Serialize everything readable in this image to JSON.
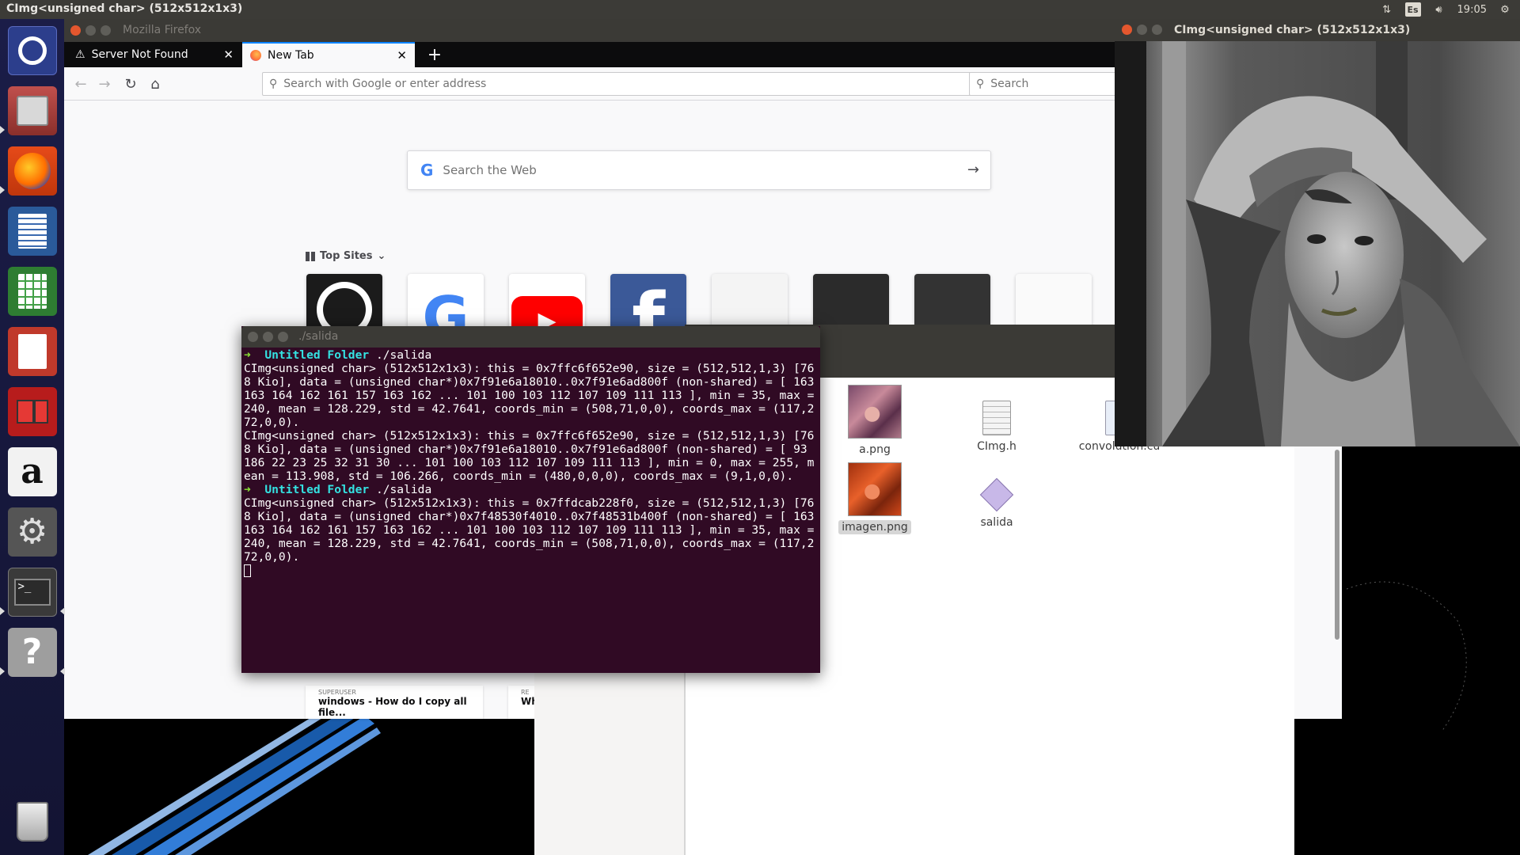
{
  "top_panel": {
    "title": "CImg<unsigned char> (512x512x1x3)",
    "keyboard": "Es",
    "clock": "19:05"
  },
  "launcher": {
    "items": [
      "ubuntu-dash",
      "files",
      "firefox",
      "libreoffice-writer",
      "libreoffice-calc",
      "libreoffice-impress",
      "software-center-red",
      "amazon",
      "system-settings",
      "terminal",
      "help",
      "trash"
    ]
  },
  "firefox": {
    "window_title": "Mozilla Firefox",
    "tabs": [
      {
        "label": "Server Not Found"
      },
      {
        "label": "New Tab"
      }
    ],
    "url_placeholder": "Search with Google or enter address",
    "search_placeholder": "Search",
    "web_search_placeholder": "Search the Web",
    "top_sites_label": "Top Sites",
    "highlights": [
      {
        "source": "SUPERUSER",
        "title": "windows - How do I copy all file..."
      },
      {
        "source": "RE",
        "title": "Wh"
      }
    ]
  },
  "file_manager": {
    "files": [
      {
        "name": "a.png"
      },
      {
        "name": "CImg.h"
      },
      {
        "name": "convolution.cu"
      },
      {
        "name": "imagen.png"
      },
      {
        "name": "salida"
      }
    ]
  },
  "cimg_window": {
    "title": "CImg<unsigned char> (512x512x1x3)"
  },
  "terminal": {
    "title": "./salida",
    "prompt_dir": "Untitled Folder",
    "command": "./salida",
    "output_1": "CImg<unsigned char> (512x512x1x3): this = 0x7ffc6f652e90, size = (512,512,1,3) [768 Kio], data = (unsigned char*)0x7f91e6a18010..0x7f91e6ad800f (non-shared) = [ 163 163 164 162 161 157 163 162 ... 101 100 103 112 107 109 111 113 ], min = 35, max = 240, mean = 128.229, std = 42.7641, coords_min = (508,71,0,0), coords_max = (117,272,0,0).",
    "output_2": "CImg<unsigned char> (512x512x1x3): this = 0x7ffc6f652e90, size = (512,512,1,3) [768 Kio], data = (unsigned char*)0x7f91e6a18010..0x7f91e6ad800f (non-shared) = [ 93 186 22 23 25 32 31 30 ... 101 100 103 112 107 109 111 113 ], min = 0, max = 255, mean = 113.908, std = 106.266, coords_min = (480,0,0,0), coords_max = (9,1,0,0).",
    "output_3": "CImg<unsigned char> (512x512x1x3): this = 0x7ffdcab228f0, size = (512,512,1,3) [768 Kio], data = (unsigned char*)0x7f48530f4010..0x7f48531b400f (non-shared) = [ 163 163 164 162 161 157 163 162 ... 101 100 103 112 107 109 111 113 ], min = 35, max = 240, mean = 128.229, std = 42.7641, coords_min = (508,71,0,0), coords_max = (117,272,0,0)."
  }
}
